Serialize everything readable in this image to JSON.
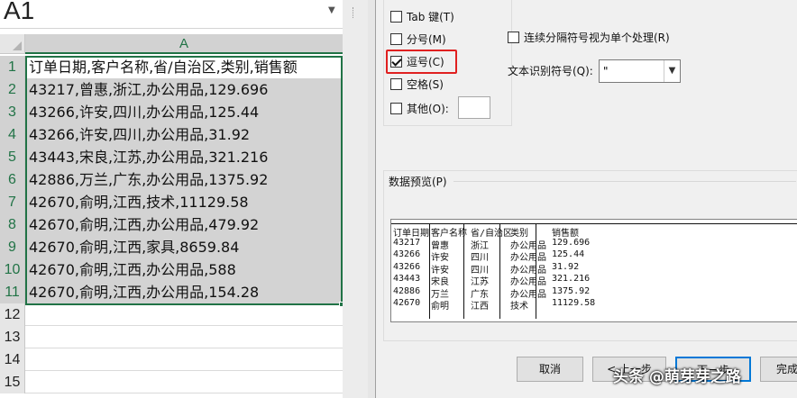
{
  "excel": {
    "name_box": "A1",
    "column_header": "A",
    "rows": [
      {
        "num": "1",
        "value": "订单日期,客户名称,省/自治区,类别,销售额"
      },
      {
        "num": "2",
        "value": "43217,曾惠,浙江,办公用品,129.696"
      },
      {
        "num": "3",
        "value": "43266,许安,四川,办公用品,125.44"
      },
      {
        "num": "4",
        "value": "43266,许安,四川,办公用品,31.92"
      },
      {
        "num": "5",
        "value": "43443,宋良,江苏,办公用品,321.216"
      },
      {
        "num": "6",
        "value": "42886,万兰,广东,办公用品,1375.92"
      },
      {
        "num": "7",
        "value": "42670,俞明,江西,技术,11129.58"
      },
      {
        "num": "8",
        "value": "42670,俞明,江西,办公用品,479.92"
      },
      {
        "num": "9",
        "value": "42670,俞明,江西,家具,8659.84"
      },
      {
        "num": "10",
        "value": "42670,俞明,江西,办公用品,588"
      },
      {
        "num": "11",
        "value": "42670,俞明,江西,办公用品,154.28"
      },
      {
        "num": "12",
        "value": ""
      },
      {
        "num": "13",
        "value": ""
      },
      {
        "num": "14",
        "value": ""
      },
      {
        "num": "15",
        "value": ""
      }
    ],
    "accent_color": "#217346"
  },
  "dialog": {
    "delimiters": [
      {
        "label": "Tab 键(T)",
        "checked": false
      },
      {
        "label": "分号(M)",
        "checked": false
      },
      {
        "label": "逗号(C)",
        "checked": true
      },
      {
        "label": "空格(S)",
        "checked": false
      },
      {
        "label": "其他(O):",
        "checked": false
      }
    ],
    "consecutive_label": "连续分隔符号视为单个处理(R)",
    "consecutive_checked": false,
    "text_qualifier_label": "文本识别符号(Q):",
    "text_qualifier_value": "\"",
    "preview_label": "数据预览(P)",
    "preview_rows": [
      [
        "订单日期",
        "客户名称",
        "省/自治区",
        "类别",
        "销售额"
      ],
      [
        "43217",
        "曾惠",
        "浙江",
        "办公用品",
        "129.696"
      ],
      [
        "43266",
        "许安",
        "四川",
        "办公用品",
        "125.44"
      ],
      [
        "43266",
        "许安",
        "四川",
        "办公用品",
        "31.92"
      ],
      [
        "43443",
        "宋良",
        "江苏",
        "办公用品",
        "321.216"
      ],
      [
        "42886",
        "万兰",
        "广东",
        "办公用品",
        "1375.92"
      ],
      [
        "42670",
        "俞明",
        "江西",
        "技术",
        "11129.58"
      ]
    ],
    "buttons": {
      "cancel": "取消",
      "back": "< 上一步",
      "next": "下一步",
      "finish": "完成"
    },
    "highlight_color": "#e02020"
  },
  "watermark": "头条 @萌芽芽之路"
}
